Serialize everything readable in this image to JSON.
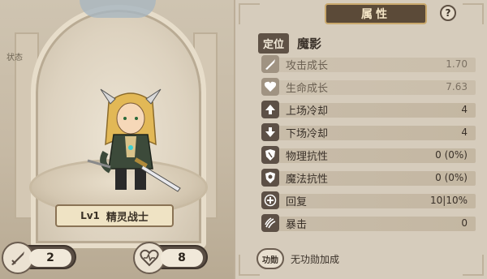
{
  "left": {
    "status_label": "状态",
    "hero": {
      "level": "Lv1",
      "name": "精灵战士"
    },
    "attack": {
      "icon": "sword-icon",
      "value": "2"
    },
    "health": {
      "icon": "heart-pulse-icon",
      "value": "8"
    }
  },
  "right": {
    "title": "属性",
    "help": "?",
    "position": {
      "label": "定位",
      "value": "魔影"
    },
    "attributes": [
      {
        "icon": "sword-growth-icon",
        "label": "攻击成长",
        "value": "1.70",
        "faded": true
      },
      {
        "icon": "heart-growth-icon",
        "label": "生命成长",
        "value": "7.63",
        "faded": true
      },
      {
        "icon": "arrow-up-icon",
        "label": "上场冷却",
        "value": "4",
        "faded": false
      },
      {
        "icon": "arrow-down-icon",
        "label": "下场冷却",
        "value": "4",
        "faded": false
      },
      {
        "icon": "physical-shield-icon",
        "label": "物理抗性",
        "value": "0 (0%)",
        "faded": false
      },
      {
        "icon": "magic-shield-icon",
        "label": "魔法抗性",
        "value": "0 (0%)",
        "faded": false
      },
      {
        "icon": "plus-icon",
        "label": "回复",
        "value": "10|10%",
        "faded": false
      },
      {
        "icon": "claw-icon",
        "label": "暴击",
        "value": "0",
        "faded": false
      }
    ],
    "bonus": {
      "badge": "功勋",
      "text": "无功勋加成"
    }
  },
  "colors": {
    "panel_dark": "#5d5046",
    "title_banner": "#5b4a38",
    "accent_gold": "#c9a86c"
  }
}
